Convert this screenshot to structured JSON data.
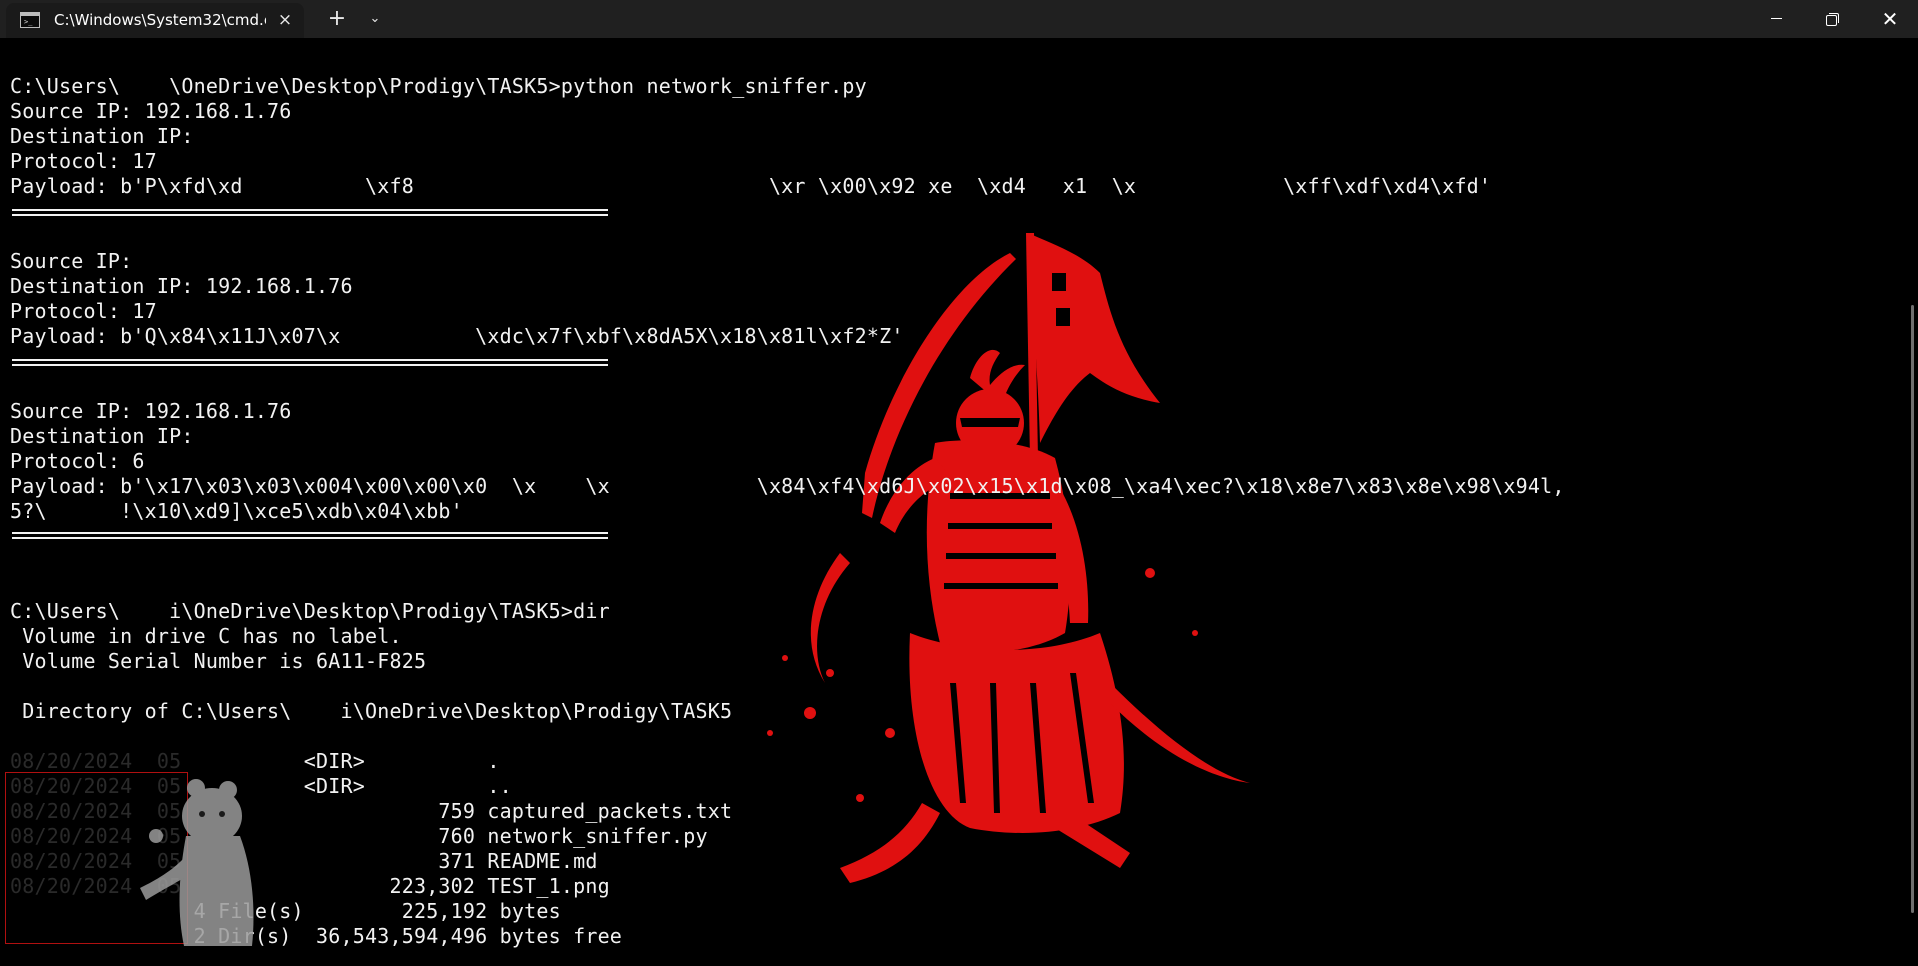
{
  "window": {
    "tab_title": "C:\\Windows\\System32\\cmd.e",
    "tab_icon": "console-icon",
    "close_tab_icon": "×",
    "new_tab_icon": "+",
    "dropdown_icon": "⌄",
    "minimize_icon": "minimize-icon",
    "restore_icon": "restore-icon",
    "close_icon": "✕"
  },
  "console": {
    "lines": [
      "C:\\Users\\    \\OneDrive\\Desktop\\Prodigy\\TASK5>python network_sniffer.py",
      "Source IP: 192.168.1.76",
      "Destination IP:",
      "Protocol: 17",
      "Payload: b'P\\xfd\\xd          \\xf8                             \\xr \\x00\\x92 xe  \\xd4   x1  \\x            \\xff\\xdf\\xd4\\xfd'",
      "Source IP:",
      "Destination IP: 192.168.1.76",
      "Protocol: 17",
      "Payload: b'Q\\x84\\x11J\\x07\\x           \\xdc\\x7f\\xbf\\x8dA5X\\x18\\x81l\\xf2*Z'",
      "Source IP: 192.168.1.76",
      "Destination IP:",
      "Protocol: 6",
      "Payload: b'\\x17\\x03\\x03\\x004\\x00\\x00\\x0  \\x    \\x            \\x84\\xf4\\xd6J\\x02\\x15\\x1d\\x08_\\xa4\\xec?\\x18\\x8e7\\x83\\x8e\\x98\\x94l,",
      "5?\\      !\\x10\\xd9]\\xce5\\xdb\\x04\\xbb'",
      "C:\\Users\\    i\\OneDrive\\Desktop\\Prodigy\\TASK5>dir",
      " Volume in drive C has no label.",
      " Volume Serial Number is 6A11-F825",
      " Directory of C:\\Users\\    i\\OneDrive\\Desktop\\Prodigy\\TASK5",
      "                        <DIR>          .",
      "                        <DIR>          ..",
      "                                   759 captured_packets.txt",
      "                                   760 network_sniffer.py",
      "                                   371 README.md",
      "                               223,302 TEST_1.png",
      "               4 File(s)        225,192 bytes",
      "               2 Dir(s)  36,543,594,496 bytes free"
    ],
    "dim_dates": [
      "08/20/2024  05",
      "08/20/2024  05",
      "08/20/2024  05",
      "08/20/2024  05",
      "08/20/2024  05",
      "08/20/2024  05"
    ]
  },
  "colors": {
    "background": "#000000",
    "text": "#f2f2f2",
    "titlebar": "#202020",
    "samurai_red": "#e01010"
  }
}
